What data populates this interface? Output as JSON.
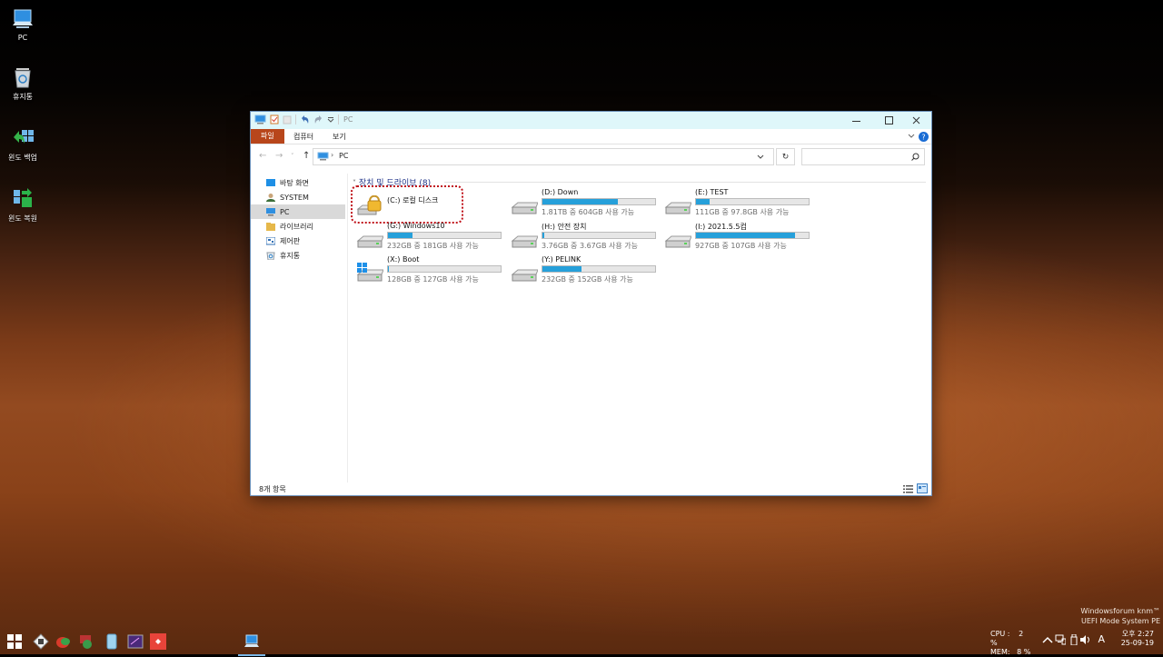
{
  "desktop": {
    "icons": [
      {
        "label": "PC",
        "icon": "computer-icon"
      },
      {
        "label": "휴지통",
        "icon": "recycle-bin-icon"
      },
      {
        "label": "윈도 백업",
        "icon": "backup-icon"
      },
      {
        "label": "윈도 복원",
        "icon": "restore-icon"
      }
    ],
    "watermark": {
      "line1": "Windowsforum knm™",
      "line2": "UEFI Mode System PE"
    }
  },
  "window": {
    "title": "PC",
    "ribbon_tabs": [
      "파일",
      "컴퓨터",
      "보기"
    ],
    "address_path": "PC",
    "search_placeholder": "",
    "sidebar": [
      {
        "label": "바탕 화면",
        "icon": "desktop-folder-icon"
      },
      {
        "label": "SYSTEM",
        "icon": "user-icon"
      },
      {
        "label": "PC",
        "icon": "computer-icon",
        "selected": true
      },
      {
        "label": "라이브러리",
        "icon": "library-icon"
      },
      {
        "label": "제어판",
        "icon": "control-panel-icon"
      },
      {
        "label": "휴지통",
        "icon": "recycle-bin-icon"
      }
    ],
    "group_header": "장치 및 드라이브 (8)",
    "drives": [
      {
        "name": "(C:) 로컬 디스크",
        "free_text": "",
        "used_fraction": null,
        "icon": "locked-drive-icon",
        "highlighted": true
      },
      {
        "name": "(D:) Down",
        "free_text": "1.81TB 중 604GB 사용 가능",
        "used_fraction": 0.67,
        "icon": "hard-drive-icon"
      },
      {
        "name": "(E:) TEST",
        "free_text": "111GB 중 97.8GB 사용 가능",
        "used_fraction": 0.12,
        "icon": "hard-drive-icon"
      },
      {
        "name": "(G:) Windows10",
        "free_text": "232GB 중 181GB 사용 가능",
        "used_fraction": 0.22,
        "icon": "hard-drive-icon"
      },
      {
        "name": "(H:) 안전 장치",
        "free_text": "3.76GB 중 3.67GB 사용 가능",
        "used_fraction": 0.02,
        "icon": "hard-drive-icon"
      },
      {
        "name": "(I:) 2021.5.5컴",
        "free_text": "927GB 중 107GB 사용 가능",
        "used_fraction": 0.88,
        "icon": "hard-drive-icon"
      },
      {
        "name": "(X:) Boot",
        "free_text": "128GB 중 127GB 사용 가능",
        "used_fraction": 0.01,
        "icon": "windows-drive-icon"
      },
      {
        "name": "(Y:) PELINK",
        "free_text": "232GB 중 152GB 사용 가능",
        "used_fraction": 0.35,
        "icon": "hard-drive-icon"
      }
    ],
    "status": "8개 항목"
  },
  "taskbar": {
    "cpu_label": "CPU :",
    "cpu_value": "2 %",
    "mem_label": "MEM:",
    "mem_value": "8 %",
    "ime": "A",
    "time": "오후 2:27",
    "date": "25-09-19"
  },
  "colors": {
    "accent": "#26a0da",
    "file_tab": "#b8461b",
    "titlebar": "#dff7fa",
    "highlight_border": "#c0141c"
  }
}
